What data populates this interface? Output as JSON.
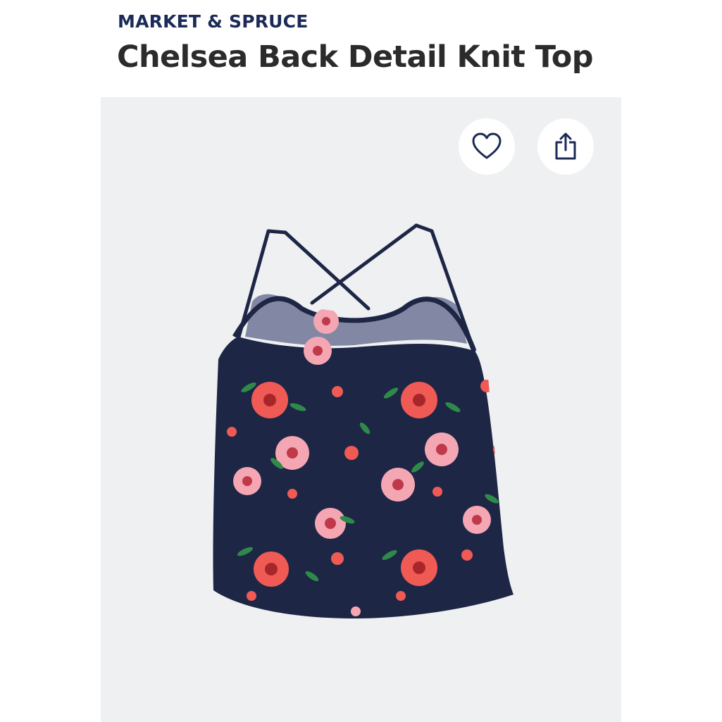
{
  "product": {
    "brand": "MARKET & SPRUCE",
    "name": "Chelsea Back Detail Knit Top"
  },
  "actions": {
    "favorite_icon": "heart-icon",
    "share_icon": "share-icon"
  },
  "colors": {
    "brand_text": "#1b2a57",
    "title_text": "#2b2b2b",
    "image_background": "#eef0f2",
    "garment_navy": "#1e2645",
    "flower_coral": "#ef5a55",
    "flower_pink": "#f4a6b3",
    "leaf_green": "#2f8a4a"
  }
}
